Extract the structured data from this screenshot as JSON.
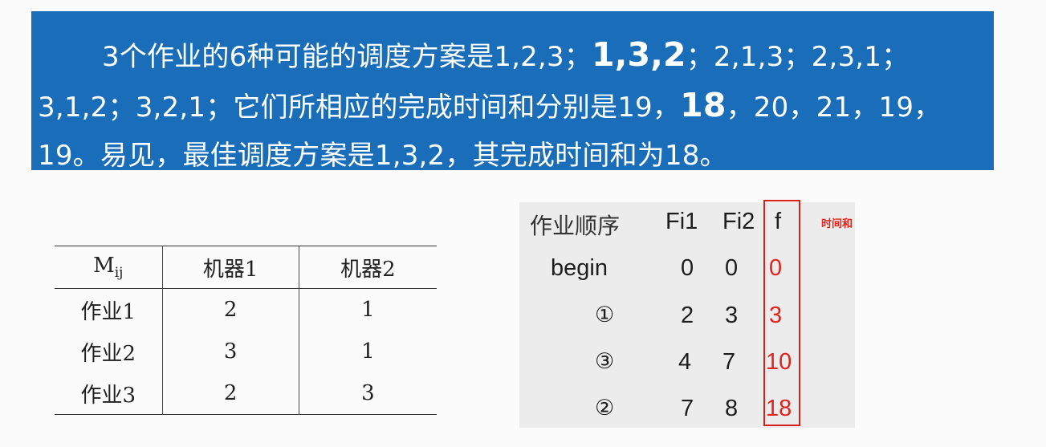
{
  "banner": {
    "line_a": "3个作业的6种可能的调度方案是1,2,3；",
    "line_b": "1,3,2",
    "line_c": "；2,1,3；2,3,1；3,1,2；3,2,1；它们所相应的完成时间和分别是19，",
    "line_d": "18",
    "line_e": "，20，21，19，19。易见，最佳调度方案是1,3,2，其完成时间和为18。"
  },
  "machine_table": {
    "corner_main": "M",
    "corner_sub": "ij",
    "headers": [
      "机器1",
      "机器2"
    ],
    "rows": [
      {
        "job": "作业1",
        "m1": "2",
        "m2": "1"
      },
      {
        "job": "作业2",
        "m1": "3",
        "m2": "1"
      },
      {
        "job": "作业3",
        "m1": "2",
        "m2": "3"
      }
    ]
  },
  "schedule_table": {
    "headers": {
      "order": "作业顺序",
      "fi1": "Fi1",
      "fi2": "Fi2",
      "f": "f"
    },
    "rows": [
      {
        "order": "begin",
        "fi1": "0",
        "fi2": "0",
        "f": "0"
      },
      {
        "order": "①",
        "fi1": "2",
        "fi2": "3",
        "f": "3"
      },
      {
        "order": "③",
        "fi1": "4",
        "fi2": "7",
        "f": "10"
      },
      {
        "order": "②",
        "fi1": "7",
        "fi2": "8",
        "f": "18"
      }
    ],
    "note": "时间和"
  },
  "colors": {
    "banner_bg": "#1a6db8",
    "highlight_red": "#e0231c"
  }
}
